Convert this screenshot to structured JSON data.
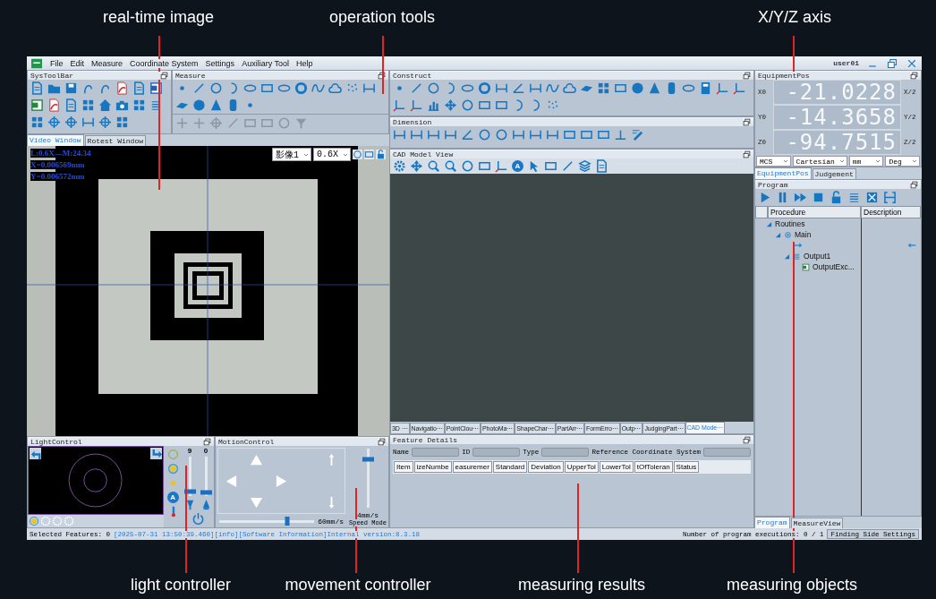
{
  "annotations": {
    "top": [
      {
        "label": "real-time image"
      },
      {
        "label": "operation tools"
      },
      {
        "label": "X/Y/Z axis"
      }
    ],
    "bottom": [
      {
        "label": "light controller"
      },
      {
        "label": "movement controller"
      },
      {
        "label": "measuring results"
      },
      {
        "label": "measuring objects"
      }
    ]
  },
  "window": {
    "menu": [
      "File",
      "Edit",
      "Measure",
      "Coordinate System",
      "Settings",
      "Auxiliary Tool",
      "Help"
    ],
    "user": "user01"
  },
  "sys_toolbar": {
    "title": "SysToolBar"
  },
  "measure_toolbar": {
    "title": "Measure"
  },
  "construct_toolbar": {
    "title": "Construct"
  },
  "dimension_toolbar": {
    "title": "Dimension"
  },
  "video_tabs": [
    {
      "label": "Video Window",
      "selected": true
    },
    {
      "label": "Rotest Window",
      "selected": false
    }
  ],
  "video": {
    "overlay": [
      "L:0.6X—M:24.34",
      "X=0.006569mm",
      "Y=0.006572mm"
    ],
    "camera": "影像1",
    "zoom": "0.6X"
  },
  "cad_view": {
    "title": "CAD Model View",
    "a_button": "A",
    "tabs": [
      {
        "label": "3D ⋯",
        "selected": false
      },
      {
        "label": "Navigatio⋯",
        "selected": false
      },
      {
        "label": "PointClou⋯",
        "selected": false
      },
      {
        "label": "PhotoMa⋯",
        "selected": false
      },
      {
        "label": "ShapeChar⋯",
        "selected": false
      },
      {
        "label": "PartArr⋯",
        "selected": false
      },
      {
        "label": "FormErro⋯",
        "selected": false
      },
      {
        "label": "Outp⋯",
        "selected": false
      },
      {
        "label": "JudgingPart⋯",
        "selected": false
      },
      {
        "label": "CAD Mode⋯",
        "selected": true
      }
    ]
  },
  "light_control": {
    "title": "LightControl",
    "auto_button": "A",
    "sliders": [
      {
        "reading": "9",
        "level": 0.12
      },
      {
        "reading": "0",
        "level": 0.1
      }
    ]
  },
  "motion_control": {
    "title": "MotionControl",
    "z_speed": {
      "level": 0.82,
      "reading": "4mm/s"
    },
    "mode": "Speed Mode",
    "xy_speed": {
      "level": 0.72,
      "reading": "60mm/s"
    }
  },
  "feature_details": {
    "title": "Feature Details",
    "fields": [
      {
        "label": "Name"
      },
      {
        "label": "ID"
      },
      {
        "label": "Type"
      },
      {
        "label": "Reference Coordinate System"
      }
    ],
    "columns": [
      "Item",
      "izeNumbe",
      "easuremer",
      "Standard",
      "Deviation",
      "UpperTol",
      "LowerTol",
      "tOfToleran",
      "Status"
    ]
  },
  "equipment_pos": {
    "title": "EquipmentPos",
    "axes": [
      {
        "label": "X0",
        "value": "-21.0228",
        "unit": "X/2"
      },
      {
        "label": "Y0",
        "value": "-14.3658",
        "unit": "Y/2"
      },
      {
        "label": "Z0",
        "value": "-94.7515",
        "unit": "Z/2"
      }
    ],
    "selects": [
      "MCS",
      "Cartesian",
      "mm",
      "Deg"
    ]
  },
  "right_tabs": [
    {
      "label": "EquipmentPos",
      "selected": true
    },
    {
      "label": "Judgement",
      "selected": false
    }
  ],
  "program": {
    "title": "Program",
    "columns": [
      "Procedure",
      "Description"
    ],
    "tree": [
      {
        "label": "Routines",
        "kind": "group",
        "expanded": true,
        "children": [
          {
            "label": "Main",
            "kind": "procedure",
            "expanded": true,
            "children": [
              {
                "label": "Output1",
                "kind": "output",
                "expanded": true,
                "children": [
                  {
                    "label": "OutputExc...",
                    "kind": "export"
                  }
                ]
              }
            ]
          }
        ]
      }
    ]
  },
  "bottom_tabs": [
    {
      "label": "Program",
      "selected": true
    },
    {
      "label": "MeasureView",
      "selected": false
    }
  ],
  "status_bar": {
    "selected": "Selected Features: 0",
    "log": "[2025-07-31 13:50:39.460][info][Software Information]Internal version:8.3.18",
    "executions": "Number of program executions: 0 / 1",
    "button": "Finding Side Settings"
  }
}
